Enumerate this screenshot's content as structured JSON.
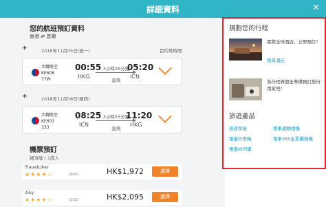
{
  "header": {
    "title": "詳細資料",
    "close_label": "✕"
  },
  "left": {
    "section_title": "您的航班預訂資料",
    "route": {
      "from": "香港",
      "to": "首爾"
    },
    "outbound": {
      "date": "2018年11月05日(週一)",
      "time_note": "目的地時間",
      "airline_name": "大韓航空",
      "flight_no": "KE608",
      "aircraft": "77W",
      "depart_time": "00:55",
      "depart_airport": "HKG",
      "duration": "3小時25分鐘",
      "stops": "直飛",
      "arrive_time": "05:20",
      "arrive_airport": "ICN"
    },
    "inbound": {
      "date": "2018年11月08日(週四)",
      "airline_name": "大韓航空",
      "flight_no": "KE603",
      "aircraft": "333",
      "depart_time": "08:25",
      "depart_airport": "ICN",
      "duration": "3小時55分鐘",
      "stops": "直飛",
      "arrive_time": "11:20",
      "arrive_airport": "HKG"
    },
    "booking_title": "機票預訂",
    "travellers": "經濟艙 | 1成人",
    "agents": [
      {
        "name": "TravelLiker",
        "rating": 4,
        "reviews": "(445)",
        "price": "HK$1,972",
        "button": "選擇"
      },
      {
        "name": "iSky",
        "rating": 4,
        "reviews": "(253)",
        "price": "HK$2,095",
        "button": "選擇"
      }
    ]
  },
  "right": {
    "plan_title": "規劃您的行程",
    "promo1": "需覽全球酒店，立即預訂！",
    "promo1_link": "搜尋酒店",
    "promo2": "為行程做個全準備預訂旅行用家吧！",
    "products_title": "旅遊產品",
    "links": [
      "旅遊保險",
      "租車運動相機",
      "租借行李箱",
      "租車360全景攝錄機",
      "租借WiFi蛋"
    ]
  },
  "colors": {
    "header": "#2fb5c5",
    "accent": "#f0822a",
    "link": "#1f9ac0",
    "highlight": "#e0262a"
  }
}
